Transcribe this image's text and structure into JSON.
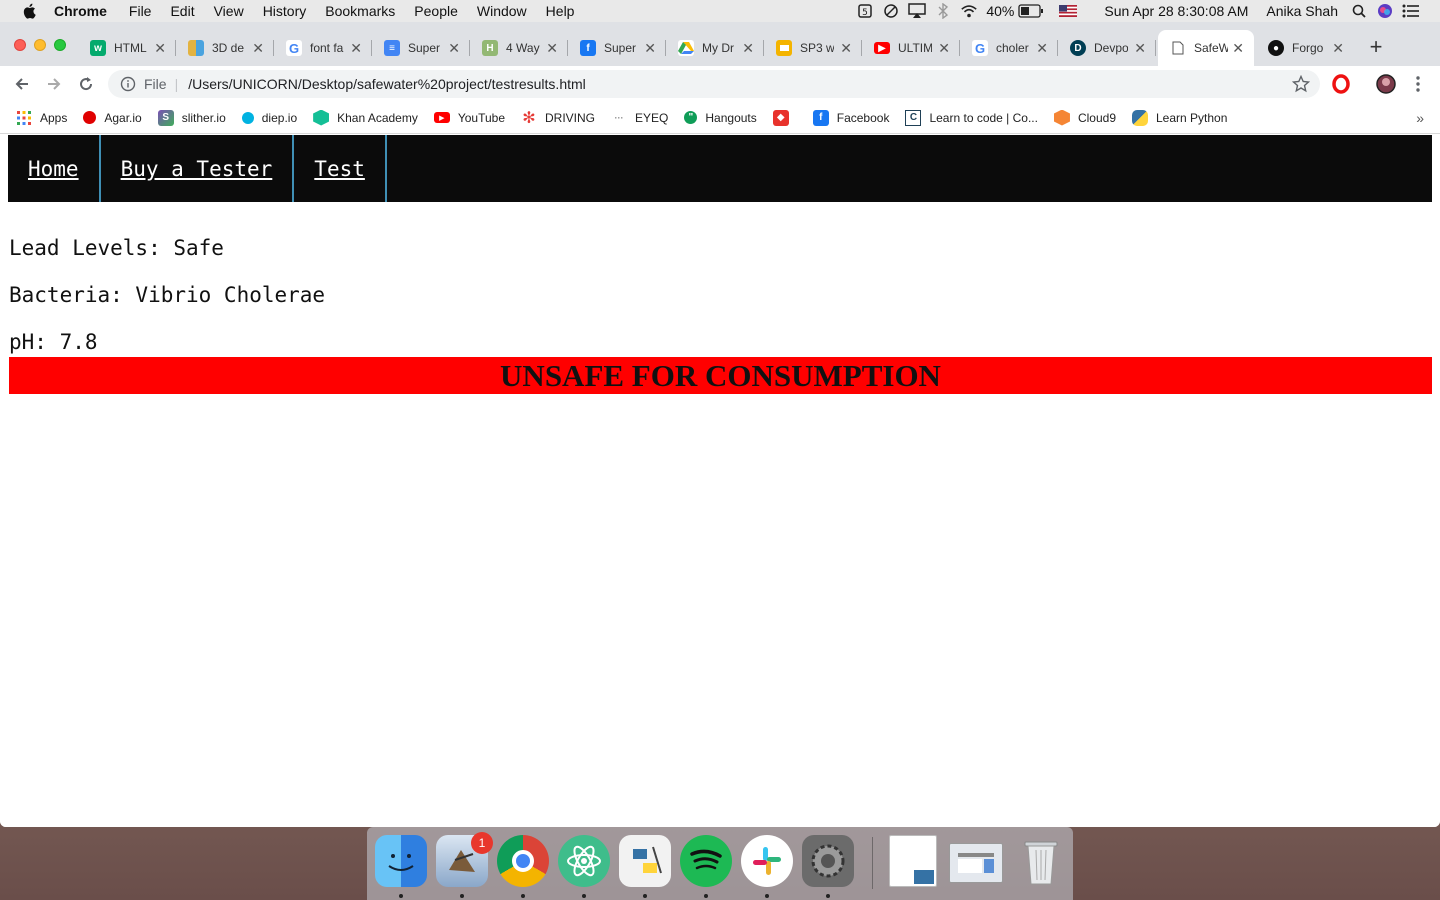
{
  "menubar": {
    "app_name": "Chrome",
    "menus": [
      "File",
      "Edit",
      "View",
      "History",
      "Bookmarks",
      "People",
      "Window",
      "Help"
    ],
    "battery": "40%",
    "datetime": "Sun Apr 28  8:30:08 AM",
    "user": "Anika Shah"
  },
  "tabs": [
    {
      "title": "HTML",
      "icon": "w3schools-icon",
      "color": "#04aa6d"
    },
    {
      "title": "3D de",
      "icon": "grid-icon",
      "color": "#e3b341"
    },
    {
      "title": "font fa",
      "icon": "google-icon",
      "color": "#4285f4"
    },
    {
      "title": "Super",
      "icon": "google-docs-icon",
      "color": "#4285f4"
    },
    {
      "title": "4 Way",
      "icon": "wikihow-icon",
      "color": "#93b874"
    },
    {
      "title": "Super",
      "icon": "facebook-icon",
      "color": "#1877f2"
    },
    {
      "title": "My Dr",
      "icon": "google-drive-icon",
      "color": "#34a853"
    },
    {
      "title": "SP3 w",
      "icon": "google-slides-icon",
      "color": "#f4b400"
    },
    {
      "title": "ULTIM",
      "icon": "youtube-icon",
      "color": "#ff0000"
    },
    {
      "title": "choler",
      "icon": "google-icon",
      "color": "#4285f4"
    },
    {
      "title": "Devpo",
      "icon": "devpost-icon",
      "color": "#003e54"
    },
    {
      "title": "SafeW",
      "icon": "page-icon",
      "color": "#ffffff",
      "active": true
    },
    {
      "title": "Forgo",
      "icon": "github-icon",
      "color": "#111111"
    }
  ],
  "omnibox": {
    "scheme": "File",
    "url": "/Users/UNICORN/Desktop/safewater%20project/testresults.html"
  },
  "bookmarks": [
    {
      "label": "Apps",
      "icon": "apps-grid-icon",
      "color": "#e8453c"
    },
    {
      "label": "Agar.io",
      "icon": "agario-icon",
      "color": "#e00000"
    },
    {
      "label": "slither.io",
      "icon": "slither-icon",
      "color": "#7a4fb5"
    },
    {
      "label": "diep.io",
      "icon": "diep-icon",
      "color": "#00b2e1"
    },
    {
      "label": "Khan Academy",
      "icon": "khan-academy-icon",
      "color": "#14bf96"
    },
    {
      "label": "YouTube",
      "icon": "youtube-icon",
      "color": "#ff0000"
    },
    {
      "label": "DRIVING",
      "icon": "driving-icon",
      "color": "#e53935"
    },
    {
      "label": "EYEQ",
      "icon": "eyeq-icon",
      "color": "#888888"
    },
    {
      "label": "Hangouts",
      "icon": "hangouts-icon",
      "color": "#0f9d58"
    },
    {
      "label": "",
      "icon": "red-bookmark-icon",
      "color": "#e8322c"
    },
    {
      "label": "Facebook",
      "icon": "facebook-icon",
      "color": "#1877f2"
    },
    {
      "label": "Learn to code | Co...",
      "icon": "codecademy-icon",
      "color": "#1f4056"
    },
    {
      "label": "Cloud9",
      "icon": "cloud9-icon",
      "color": "#f58534"
    },
    {
      "label": "Learn Python",
      "icon": "python-icon",
      "color": "#3572a5"
    }
  ],
  "page": {
    "nav": [
      "Home",
      "Buy a Tester",
      "Test"
    ],
    "results": [
      "Lead Levels: Safe",
      "Bacteria: Vibrio Cholerae",
      "pH: 7.8"
    ],
    "verdict": "UNSAFE FOR CONSUMPTION",
    "verdict_color": "#ff0000"
  },
  "dock": {
    "apps": [
      {
        "name": "finder-icon",
        "color": "#3a8ee6"
      },
      {
        "name": "mail-icon",
        "color": "#8aa7c9",
        "badge": "1"
      },
      {
        "name": "chrome-icon",
        "color": "#db4437"
      },
      {
        "name": "atom-icon",
        "color": "#3fbd8b"
      },
      {
        "name": "python-launcher-icon",
        "color": "#e8e8e8"
      },
      {
        "name": "spotify-icon",
        "color": "#1db954"
      },
      {
        "name": "slack-icon",
        "color": "#ffffff"
      },
      {
        "name": "system-preferences-icon",
        "color": "#555555"
      }
    ]
  }
}
